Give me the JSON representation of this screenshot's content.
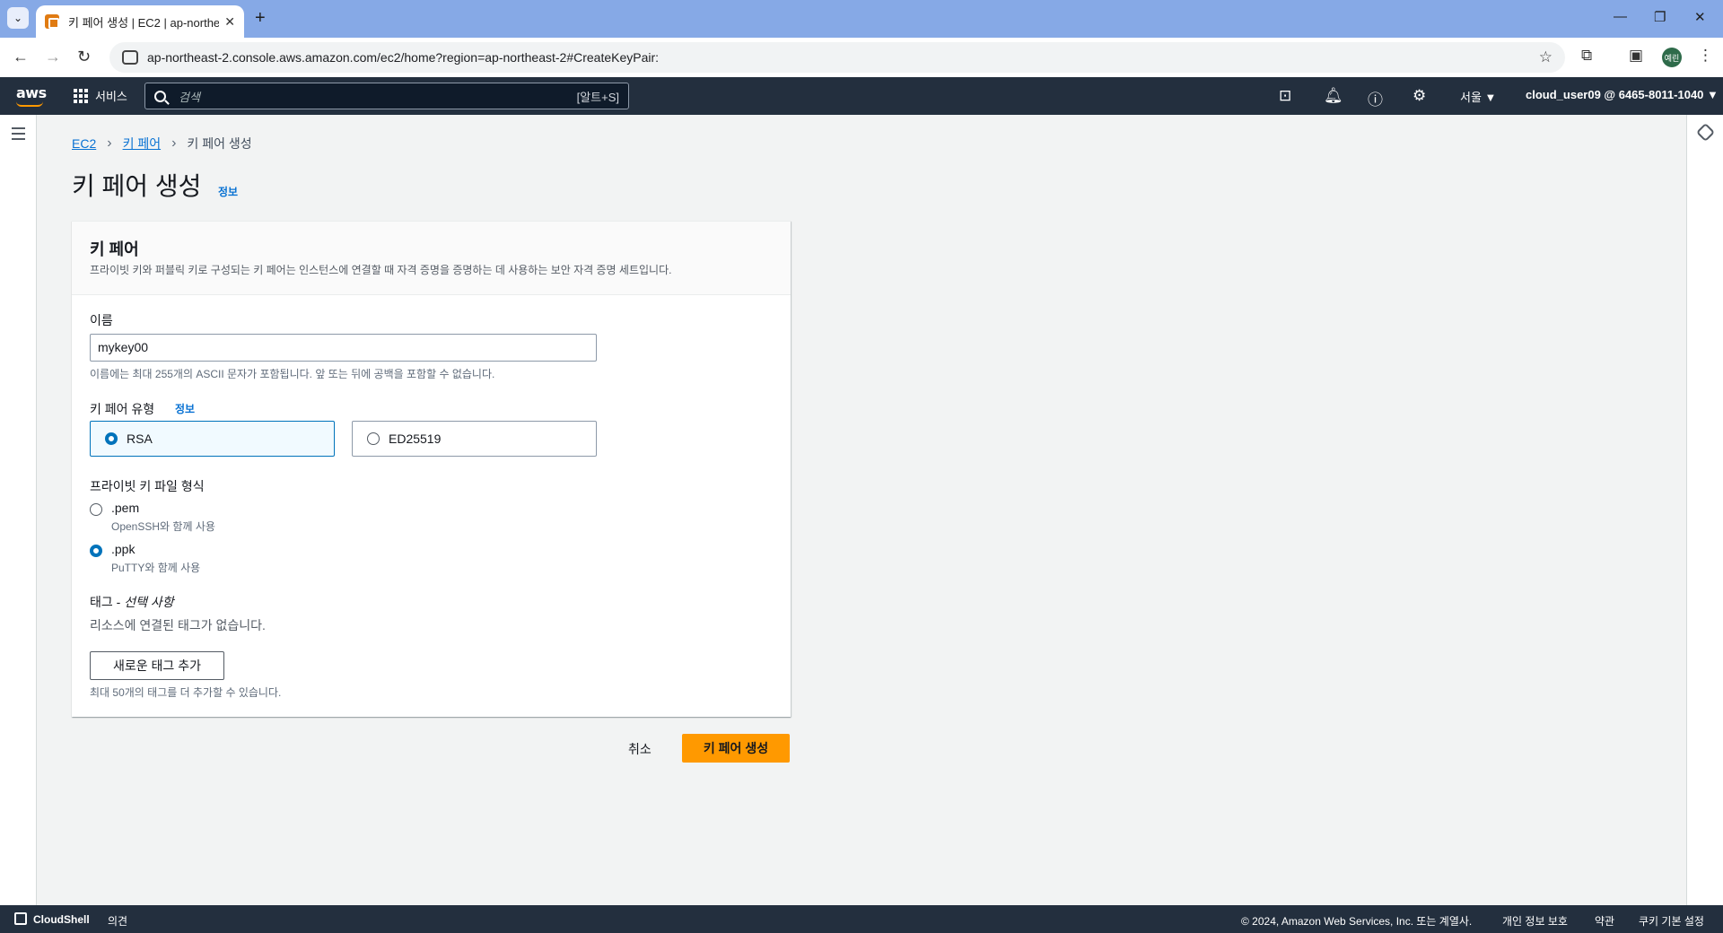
{
  "browser": {
    "tab_title": "키 페어 생성 | EC2 | ap-northeast-2",
    "url": "ap-northeast-2.console.aws.amazon.com/ec2/home?region=ap-northeast-2#CreateKeyPair:",
    "profile_initials": "예린"
  },
  "aws_header": {
    "logo": "aws",
    "services_label": "서비스",
    "search_placeholder": "검색",
    "search_shortcut": "[알트+S]",
    "region": "서울 ▼",
    "account": "cloud_user09 @ 6465-8011-1040 ▼"
  },
  "breadcrumb": {
    "items": [
      "EC2",
      "키 페어",
      "키 페어 생성"
    ]
  },
  "page": {
    "title": "키 페어 생성",
    "info_link": "정보"
  },
  "panel": {
    "title": "키 페어",
    "description": "프라이빗 키와 퍼블릭 키로 구성되는 키 페어는 인스턴스에 연결할 때 자격 증명을 증명하는 데 사용하는 보안 자격 증명 세트입니다.",
    "name_label": "이름",
    "name_value": "mykey00",
    "name_hint": "이름에는 최대 255개의 ASCII 문자가 포함됩니다. 앞 또는 뒤에 공백을 포함할 수 없습니다.",
    "type_label": "키 페어 유형",
    "type_info": "정보",
    "type_options": [
      {
        "label": "RSA",
        "selected": true
      },
      {
        "label": "ED25519",
        "selected": false
      }
    ],
    "format_label": "프라이빗 키 파일 형식",
    "format_options": [
      {
        "label": ".pem",
        "desc": "OpenSSH와 함께 사용",
        "selected": false
      },
      {
        "label": ".ppk",
        "desc": "PuTTY와 함께 사용",
        "selected": true
      }
    ],
    "tags_label": "태그 - ",
    "tags_optional": "선택 사항",
    "tags_empty": "리소스에 연결된 태그가 없습니다.",
    "add_tag_button": "새로운 태그 추가",
    "tags_hint": "최대 50개의 태그를 더 추가할 수 있습니다."
  },
  "actions": {
    "cancel": "취소",
    "create": "키 페어 생성"
  },
  "footer": {
    "cloudshell": "CloudShell",
    "feedback": "의견",
    "copyright": "© 2024, Amazon Web Services, Inc. 또는 계열사.",
    "privacy": "개인 정보 보호",
    "terms": "약관",
    "cookies": "쿠키 기본 설정"
  },
  "colors": {
    "primary_button": "#ff9900",
    "link": "#0972d3",
    "header_bg": "#232f3e"
  }
}
